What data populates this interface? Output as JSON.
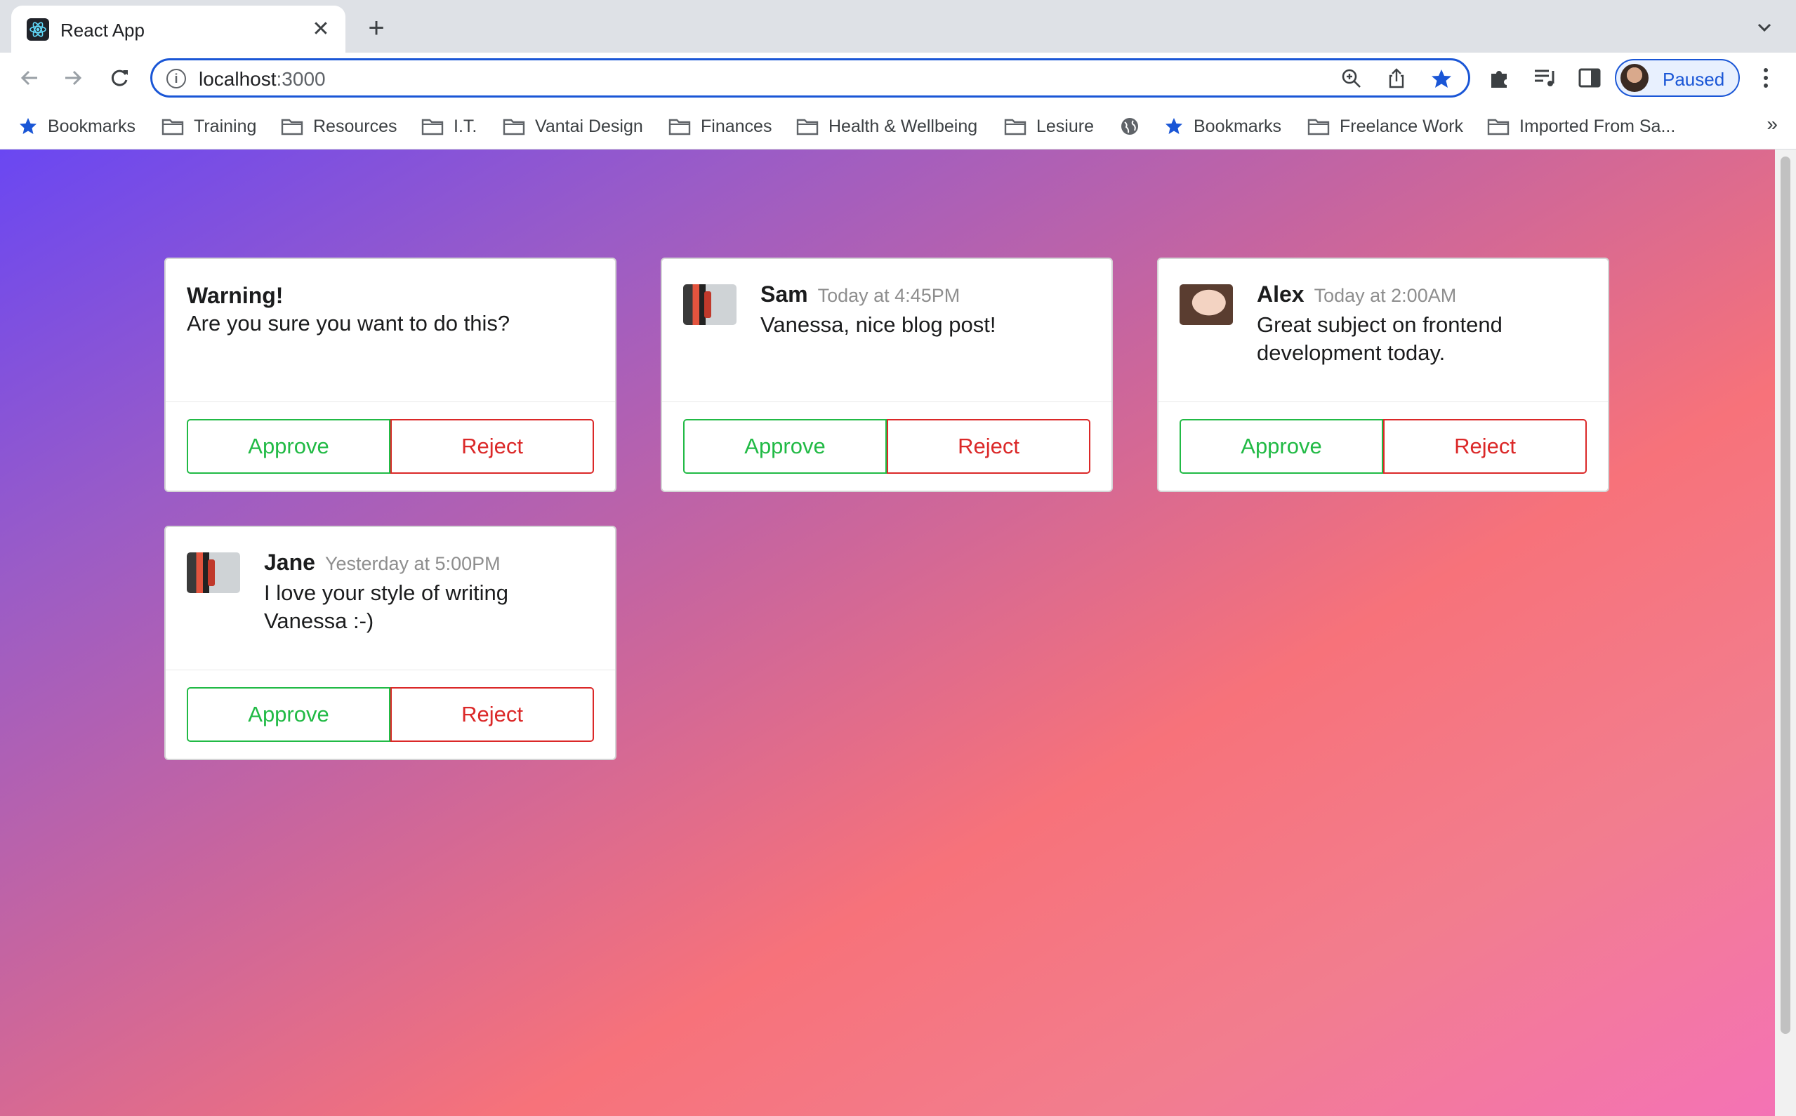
{
  "browser": {
    "tab": {
      "title": "React App",
      "favicon": "react-logo-icon",
      "close_glyph": "✕"
    },
    "new_tab_glyph": "+",
    "address": {
      "host": "localhost",
      "port": ":3000"
    },
    "profile": {
      "label": "Paused"
    },
    "bookmarks": [
      {
        "label": "Bookmarks",
        "icon": "star-icon"
      },
      {
        "label": "Training",
        "icon": "folder-icon"
      },
      {
        "label": "Resources",
        "icon": "folder-icon"
      },
      {
        "label": "I.T.",
        "icon": "folder-icon"
      },
      {
        "label": "Vantai Design",
        "icon": "folder-icon"
      },
      {
        "label": "Finances",
        "icon": "folder-icon"
      },
      {
        "label": "Health & Wellbeing",
        "icon": "folder-icon"
      },
      {
        "label": "Lesiure",
        "icon": "folder-icon"
      },
      {
        "label": "",
        "icon": "globe-icon"
      },
      {
        "label": "Bookmarks",
        "icon": "star-icon"
      },
      {
        "label": "Freelance Work",
        "icon": "folder-icon"
      },
      {
        "label": "Imported From Sa...",
        "icon": "folder-icon"
      }
    ],
    "bookmarks_more": "»"
  },
  "cards": [
    {
      "type": "warning",
      "title": "Warning!",
      "body": "Are you sure you want to do this?",
      "approve": "Approve",
      "reject": "Reject"
    },
    {
      "type": "comment",
      "author": "Sam",
      "time": "Today at 4:45PM",
      "text": "Vanessa, nice blog post!",
      "avatar": "street",
      "approve": "Approve",
      "reject": "Reject"
    },
    {
      "type": "comment",
      "author": "Alex",
      "time": "Today at 2:00AM",
      "text": "Great subject on frontend development today.",
      "avatar": "face",
      "approve": "Approve",
      "reject": "Reject"
    },
    {
      "type": "comment",
      "author": "Jane",
      "time": "Yesterday at 5:00PM",
      "text": "I love your style of writing Vanessa :-)",
      "avatar": "street",
      "approve": "Approve",
      "reject": "Reject"
    }
  ],
  "colors": {
    "approve": "#21ba45",
    "reject": "#db2828",
    "omnibox_focus": "#1a56d6"
  }
}
